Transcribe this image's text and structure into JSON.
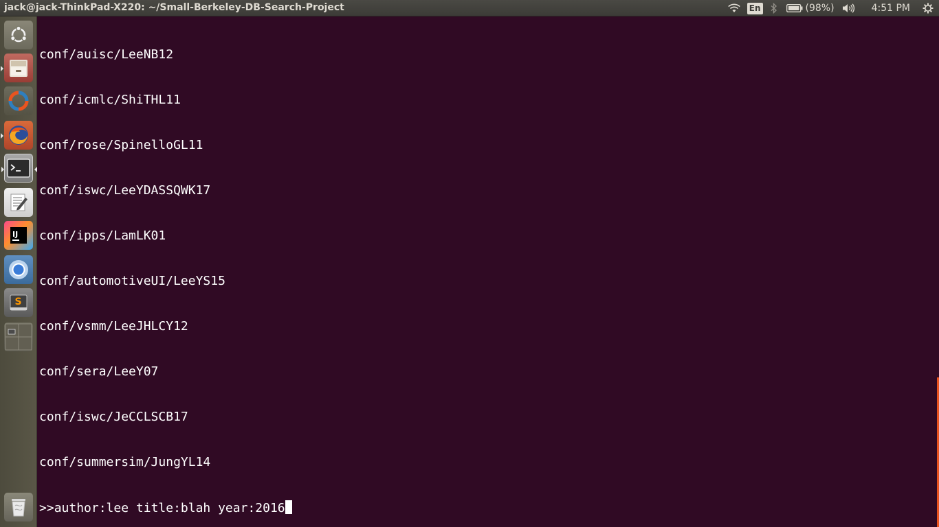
{
  "panel": {
    "window_title": "jack@jack-ThinkPad-X220: ~/Small-Berkeley-DB-Search-Project",
    "language": "En",
    "battery": "(98%)",
    "clock": "4:51 PM",
    "icons": [
      "wifi-icon",
      "bluetooth-icon",
      "battery-icon",
      "volume-icon",
      "system-gear-icon"
    ]
  },
  "launcher": {
    "items": [
      {
        "name": "dash-home",
        "icon": "ubuntu-logo-icon"
      },
      {
        "name": "files",
        "icon": "file-cabinet-icon"
      },
      {
        "name": "app-launcher",
        "icon": "ubuntu-software-icon"
      },
      {
        "name": "firefox",
        "icon": "firefox-icon"
      },
      {
        "name": "terminal",
        "icon": "terminal-icon",
        "glyph": ">_"
      },
      {
        "name": "text-editor",
        "icon": "text-editor-icon"
      },
      {
        "name": "intellij",
        "icon": "intellij-icon",
        "glyph": "IJ"
      },
      {
        "name": "chromium",
        "icon": "chromium-icon"
      },
      {
        "name": "sublime-text",
        "icon": "sublime-icon",
        "glyph": "S"
      },
      {
        "name": "workspace-switcher",
        "icon": "workspace-switcher-icon"
      },
      {
        "name": "trash",
        "icon": "trash-icon"
      }
    ]
  },
  "terminal": {
    "lines": [
      "conf/auisc/LeeNB12",
      "conf/icmlc/ShiTHL11",
      "conf/rose/SpinelloGL11",
      "conf/iswc/LeeYDASSQWK17",
      "conf/ipps/LamLK01",
      "conf/automotiveUI/LeeYS15",
      "conf/vsmm/LeeJHLCY12",
      "conf/sera/LeeY07",
      "conf/iswc/JeCCLSCB17",
      "conf/summersim/JungYL14"
    ],
    "prompt": ">>",
    "input": "author:lee title:blah year:2016"
  },
  "colors": {
    "terminal_bg": "#300a24",
    "panel_bg": "#3c3b37",
    "accent": "#e95420"
  }
}
